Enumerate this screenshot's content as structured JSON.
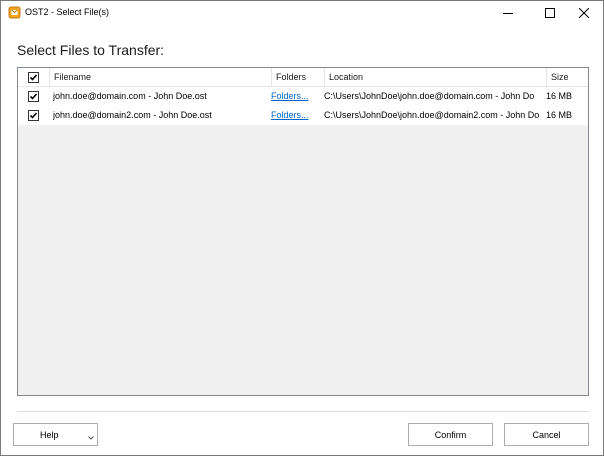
{
  "window": {
    "title": "OST2 - Select File(s)"
  },
  "heading": "Select Files to Transfer:",
  "table": {
    "columns": [
      "Filename",
      "Folders",
      "Location",
      "Size"
    ],
    "rows": [
      {
        "checked": true,
        "filename": "john.doe@domain.com - John Doe.ost",
        "folders": "Folders...",
        "location": "C:\\Users\\JohnDoe\\john.doe@domain.com - John Do",
        "size": "16 MB"
      },
      {
        "checked": true,
        "filename": "john.doe@domain2.com - John Doe.ost",
        "folders": "Folders...",
        "location": "C:\\Users\\JohnDoe\\john.doe@domain2.com - John Do",
        "size": "16 MB"
      }
    ]
  },
  "buttons": {
    "help": "Help",
    "confirm": "Confirm",
    "cancel": "Cancel"
  },
  "colors": {
    "link": "#0066cc",
    "list_background": "#f0f0f0",
    "border": "#828790"
  }
}
